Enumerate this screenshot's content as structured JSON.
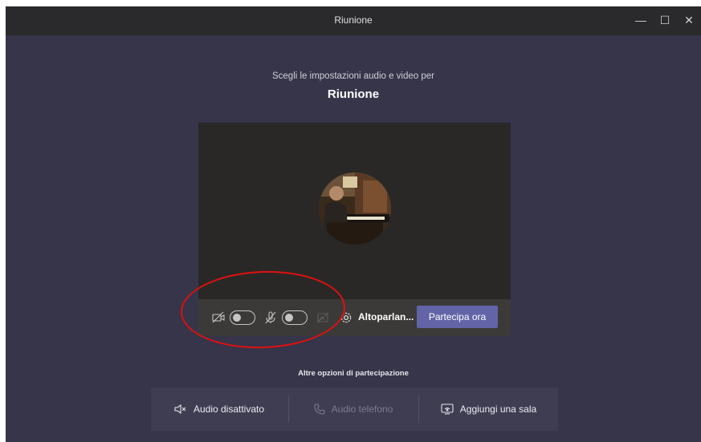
{
  "window": {
    "title": "Riunione",
    "controls": {
      "minimize": "—",
      "maximize": "☐",
      "close": "✕"
    }
  },
  "prejoin": {
    "subtitle": "Scegli le impostazioni audio e video per",
    "meeting_title": "Riunione"
  },
  "preview": {
    "video_toggle_on": false,
    "mic_toggle_on": false,
    "device_label": "Altoparlan...",
    "join_button": "Partecipa ora"
  },
  "other_options": {
    "heading": "Altre opzioni di partecipazione",
    "items": [
      {
        "label": "Audio disattivato",
        "icon": "speaker-off-icon",
        "enabled": true
      },
      {
        "label": "Audio telefono",
        "icon": "phone-icon",
        "enabled": false
      },
      {
        "label": "Aggiungi una sala",
        "icon": "room-cast-icon",
        "enabled": true
      }
    ]
  },
  "colors": {
    "background": "#36354a",
    "titlebar": "#2a2a2c",
    "accent": "#6264a7",
    "annotation": "#e01010"
  }
}
